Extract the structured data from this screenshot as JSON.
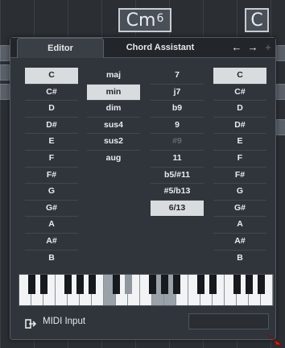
{
  "background": {
    "chords": [
      {
        "root": "Cm",
        "ext": "6"
      },
      {
        "root": "C",
        "ext": ""
      }
    ]
  },
  "tabs": [
    {
      "label": "Editor",
      "active": true
    },
    {
      "label": "Chord Assistant",
      "active": false
    }
  ],
  "nav": {
    "prev": "←",
    "next": "→",
    "add": "+"
  },
  "columns": {
    "root": {
      "items": [
        "C",
        "C#",
        "D",
        "D#",
        "E",
        "F",
        "F#",
        "G",
        "G#",
        "A",
        "A#",
        "B"
      ],
      "selected": "C"
    },
    "type": {
      "items": [
        "maj",
        "min",
        "dim",
        "sus4",
        "sus2",
        "aug"
      ],
      "selected": "min"
    },
    "tensions": {
      "items": [
        "7",
        "j7",
        "b9",
        "9",
        "#9",
        "11",
        "b5/#11",
        "#5/b13",
        "6/13"
      ],
      "selected": "6/13",
      "disabled": [
        "#9"
      ]
    },
    "bass": {
      "items": [
        "C",
        "C#",
        "D",
        "D#",
        "E",
        "F",
        "F#",
        "G",
        "G#",
        "A",
        "A#",
        "B"
      ],
      "selected": "C"
    }
  },
  "keyboard": {
    "active_keys": [
      "C",
      "D#",
      "G",
      "A"
    ]
  },
  "midi": {
    "label": "MIDI Input"
  },
  "colors": {
    "panel_bg": "#30353b",
    "selected_bg": "#d9dcdf",
    "disabled_text": "#656b72"
  }
}
